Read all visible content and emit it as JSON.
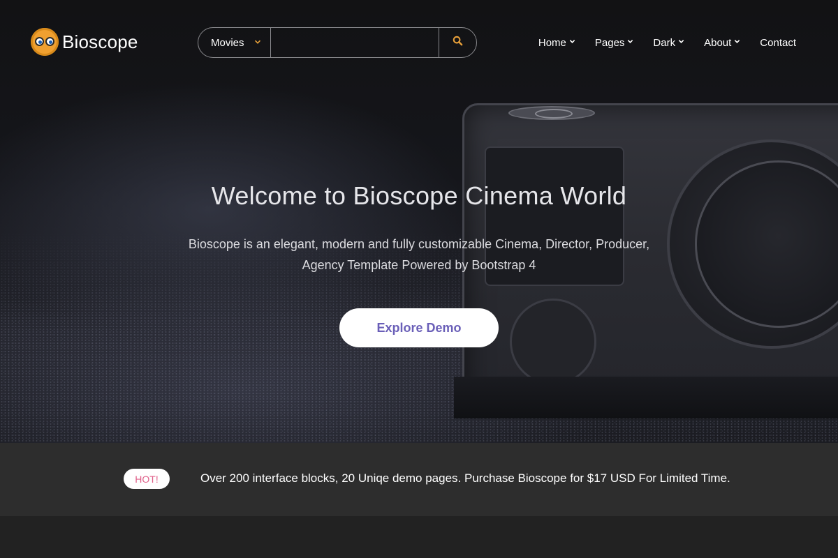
{
  "brand": {
    "name": "Bioscope",
    "logo_icon": "owl-eyes-icon"
  },
  "search": {
    "category": "Movies",
    "query": "",
    "placeholder": "",
    "chevron_icon": "chevron-down-icon",
    "button_icon": "search-icon",
    "accent_color": "#e8a03a"
  },
  "nav": {
    "items": [
      {
        "label": "Home",
        "has_dropdown": true
      },
      {
        "label": "Pages",
        "has_dropdown": true
      },
      {
        "label": "Dark",
        "has_dropdown": true
      },
      {
        "label": "About",
        "has_dropdown": true
      },
      {
        "label": "Contact",
        "has_dropdown": false
      }
    ]
  },
  "hero": {
    "title": "Welcome to Bioscope Cinema World",
    "subtitle_line1": "Bioscope is an elegant, modern and fully customizable Cinema, Director, Producer,",
    "subtitle_line2": "Agency Template Powered by Bootstrap 4",
    "cta_label": "Explore Demo",
    "cta_color": "#6a5fb8",
    "background_image": "action-camera-photo"
  },
  "promo": {
    "badge": "HOT!",
    "badge_color": "#e0608a",
    "text": "Over 200 interface blocks, 20 Uniqe demo pages. Purchase Bioscope for $17 USD For Limited Time."
  }
}
